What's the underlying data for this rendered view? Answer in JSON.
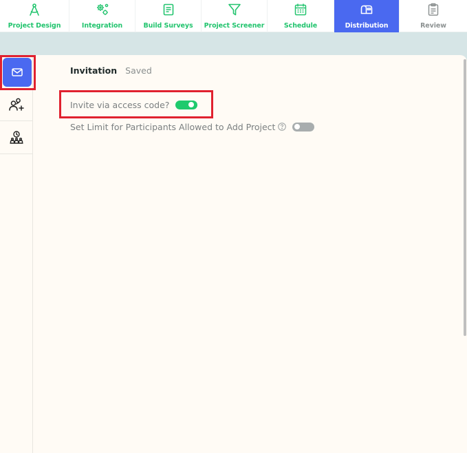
{
  "topnav": {
    "items": [
      {
        "label": "Project Design",
        "icon": "compass-icon",
        "state": "normal"
      },
      {
        "label": "Integration",
        "icon": "gears-icon",
        "state": "normal"
      },
      {
        "label": "Build Surveys",
        "icon": "document-icon",
        "state": "normal"
      },
      {
        "label": "Project Screener",
        "icon": "filter-icon",
        "state": "normal"
      },
      {
        "label": "Schedule",
        "icon": "calendar-icon",
        "state": "normal"
      },
      {
        "label": "Distribution",
        "icon": "mailbox-icon",
        "state": "active"
      },
      {
        "label": "Review",
        "icon": "clipboard-icon",
        "state": "disabled"
      }
    ]
  },
  "sidebar": {
    "items": [
      {
        "icon": "envelope-icon",
        "active": true
      },
      {
        "icon": "add-user-icon",
        "active": false
      },
      {
        "icon": "user-clock-icon",
        "active": false
      }
    ]
  },
  "content": {
    "tabs": {
      "invitation": "Invitation",
      "saved": "Saved"
    },
    "settings": {
      "access_code_label": "Invite via access code?",
      "access_code_enabled": true,
      "limit_label": "Set Limit for Participants Allowed to Add Project",
      "limit_enabled": false
    }
  },
  "colors": {
    "accent_green": "#22c46e",
    "active_blue": "#4a69f0",
    "highlight_red": "#e0212f",
    "toggle_on": "#1fca6d",
    "toggle_off": "#a8adae"
  }
}
